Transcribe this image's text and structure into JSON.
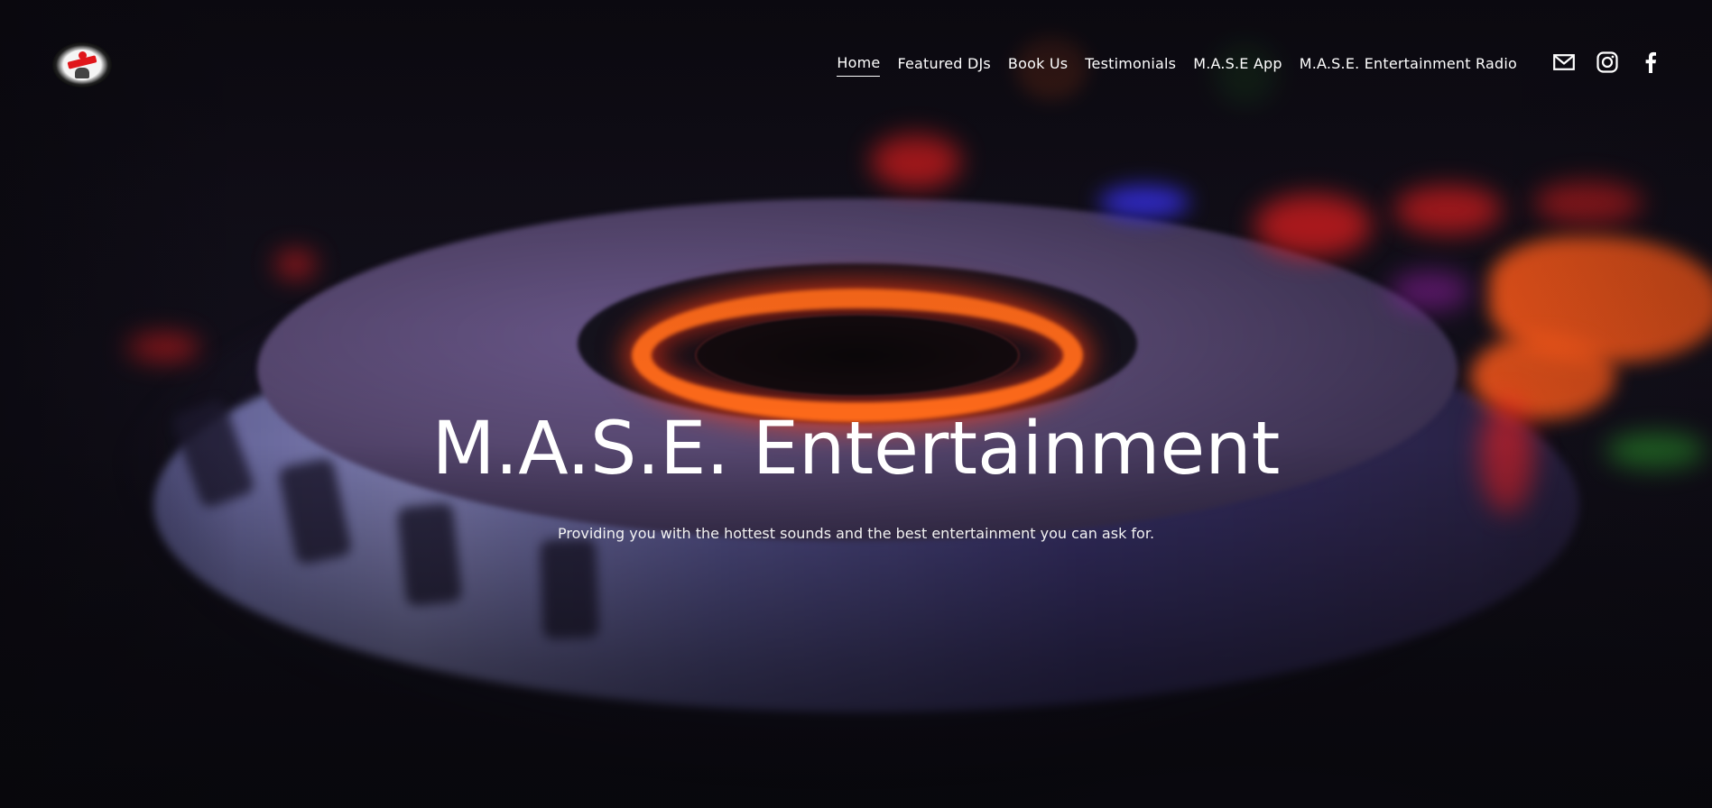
{
  "site": {
    "logo_alt": "M.A.S.E. Entertainment logo"
  },
  "nav": {
    "items": [
      {
        "label": "Home",
        "active": true
      },
      {
        "label": "Featured DJs",
        "active": false
      },
      {
        "label": "Book Us",
        "active": false
      },
      {
        "label": "Testimonials",
        "active": false
      },
      {
        "label": "M.A.S.E App",
        "active": false
      },
      {
        "label": "M.A.S.E. Entertainment Radio",
        "active": false
      }
    ]
  },
  "social": {
    "icons": [
      "email-icon",
      "instagram-icon",
      "facebook-icon"
    ]
  },
  "hero": {
    "title": "M.A.S.E. Entertainment",
    "subtitle": "Providing you with the hottest sounds and the best entertainment you can ask for."
  },
  "colors": {
    "text": "#ffffff",
    "background": "#0b0910",
    "accent_glow": "#ff5a1a"
  }
}
